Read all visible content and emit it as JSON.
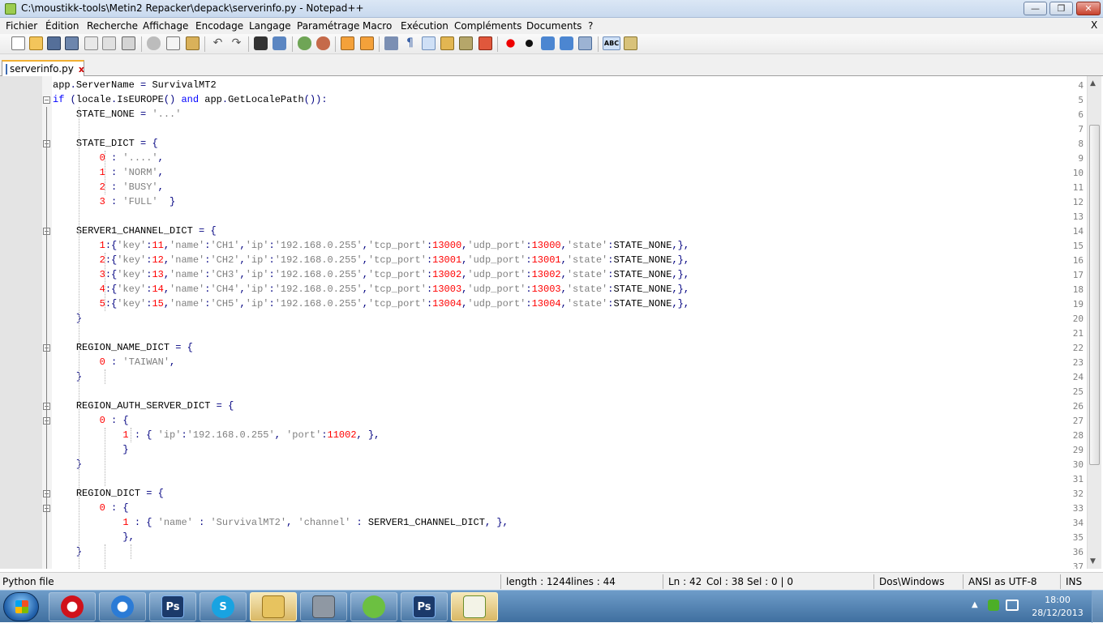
{
  "window": {
    "title": "C:\\moustikk-tools\\Metin2 Repacker\\depack\\serverinfo.py - Notepad++",
    "minimize_icon": "minimize-icon",
    "maximize_icon": "maximize-icon",
    "close_icon": "close-icon"
  },
  "menu": {
    "items": [
      "Fichier",
      "Édition",
      "Recherche",
      "Affichage",
      "Encodage",
      "Langage",
      "Paramétrage",
      "Macro",
      "Exécution",
      "Compléments",
      "Documents",
      "?"
    ],
    "close_label": "X"
  },
  "toolbar": {
    "icons": [
      "new-file-icon",
      "open-file-icon",
      "save-icon",
      "save-all-icon",
      "close-file-icon",
      "close-all-icon",
      "print-icon",
      "cut-icon",
      "copy-icon",
      "paste-icon",
      "undo-icon",
      "redo-icon",
      "find-icon",
      "replace-icon",
      "zoom-in-icon",
      "zoom-out-icon",
      "sync-vertical-icon",
      "sync-horizontal-icon",
      "word-wrap-icon",
      "show-all-chars-icon",
      "indent-guide-icon",
      "user-language-icon",
      "doc-map-icon",
      "function-list-icon",
      "record-macro-icon",
      "stop-macro-icon",
      "play-macro-icon",
      "run-macro-multiple-icon",
      "save-macro-icon",
      "spell-check-icon",
      "plugin-icon"
    ],
    "spell_label": "ABC"
  },
  "tab": {
    "label": "serverinfo.py",
    "close_label": "x"
  },
  "editor": {
    "lines": [
      {
        "n": "4",
        "fold": "",
        "text": "app.ServerName = SurvivalMT2"
      },
      {
        "n": "5",
        "fold": "minus",
        "text": "if (locale.IsEUROPE() and app.GetLocalePath()):"
      },
      {
        "n": "6",
        "fold": "",
        "text": "    STATE_NONE = '...'"
      },
      {
        "n": "7",
        "fold": "",
        "text": ""
      },
      {
        "n": "8",
        "fold": "minus",
        "text": "    STATE_DICT = {"
      },
      {
        "n": "9",
        "fold": "",
        "text": "        0 : '....',"
      },
      {
        "n": "10",
        "fold": "",
        "text": "        1 : 'NORM',"
      },
      {
        "n": "11",
        "fold": "",
        "text": "        2 : 'BUSY',"
      },
      {
        "n": "12",
        "fold": "",
        "text": "        3 : 'FULL'  }"
      },
      {
        "n": "13",
        "fold": "",
        "text": ""
      },
      {
        "n": "14",
        "fold": "minus",
        "text": "    SERVER1_CHANNEL_DICT = {"
      },
      {
        "n": "15",
        "fold": "",
        "text": "        1:{'key':11,'name':'CH1','ip':'192.168.0.255','tcp_port':13000,'udp_port':13000,'state':STATE_NONE,},"
      },
      {
        "n": "16",
        "fold": "",
        "text": "        2:{'key':12,'name':'CH2','ip':'192.168.0.255','tcp_port':13001,'udp_port':13001,'state':STATE_NONE,},"
      },
      {
        "n": "17",
        "fold": "",
        "text": "        3:{'key':13,'name':'CH3','ip':'192.168.0.255','tcp_port':13002,'udp_port':13002,'state':STATE_NONE,},"
      },
      {
        "n": "18",
        "fold": "",
        "text": "        4:{'key':14,'name':'CH4','ip':'192.168.0.255','tcp_port':13003,'udp_port':13003,'state':STATE_NONE,},"
      },
      {
        "n": "19",
        "fold": "",
        "text": "        5:{'key':15,'name':'CH5','ip':'192.168.0.255','tcp_port':13004,'udp_port':13004,'state':STATE_NONE,},"
      },
      {
        "n": "20",
        "fold": "",
        "text": "    }"
      },
      {
        "n": "21",
        "fold": "",
        "text": ""
      },
      {
        "n": "22",
        "fold": "minus",
        "text": "    REGION_NAME_DICT = {"
      },
      {
        "n": "23",
        "fold": "",
        "text": "        0 : 'TAIWAN',"
      },
      {
        "n": "24",
        "fold": "",
        "text": "    }"
      },
      {
        "n": "25",
        "fold": "",
        "text": ""
      },
      {
        "n": "26",
        "fold": "minus",
        "text": "    REGION_AUTH_SERVER_DICT = {"
      },
      {
        "n": "27",
        "fold": "minus",
        "text": "        0 : {"
      },
      {
        "n": "28",
        "fold": "",
        "text": "            1 : { 'ip':'192.168.0.255', 'port':11002, },"
      },
      {
        "n": "29",
        "fold": "",
        "text": "            }"
      },
      {
        "n": "30",
        "fold": "",
        "text": "    }"
      },
      {
        "n": "31",
        "fold": "",
        "text": ""
      },
      {
        "n": "32",
        "fold": "minus",
        "text": "    REGION_DICT = {"
      },
      {
        "n": "33",
        "fold": "minus",
        "text": "        0 : {"
      },
      {
        "n": "34",
        "fold": "",
        "text": "            1 : { 'name' : 'SurvivalMT2', 'channel' : SERVER1_CHANNEL_DICT, },"
      },
      {
        "n": "35",
        "fold": "",
        "text": "            },"
      },
      {
        "n": "36",
        "fold": "",
        "text": "    }"
      },
      {
        "n": "37",
        "fold": "",
        "text": ""
      }
    ]
  },
  "status": {
    "filetype": "Python file",
    "length": "length : 1244",
    "lines": "lines : 44",
    "ln": "Ln : 42",
    "col": "Col : 38",
    "sel": "Sel : 0 | 0",
    "eol": "Dos\\Windows",
    "encoding": "ANSI as UTF-8",
    "mode": "INS"
  },
  "taskbar": {
    "apps": [
      "opera-icon",
      "ie-icon",
      "photoshop-icon",
      "skype-icon",
      "explorer-icon",
      "installer-icon",
      "greenapp-icon",
      "photoshop2-icon",
      "notepadpp-icon"
    ],
    "ps_label": "Ps",
    "time": "18:00",
    "date": "28/12/2013"
  },
  "colors": {
    "keyword": "#0000ff",
    "number": "#ff0000",
    "string": "#808080",
    "operator": "#000080"
  }
}
